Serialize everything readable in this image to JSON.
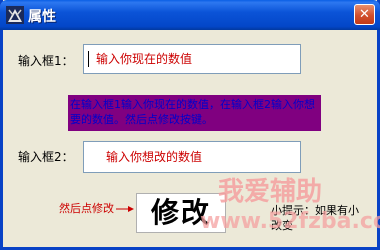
{
  "window": {
    "title": "属性",
    "close_glyph": "✕"
  },
  "field1": {
    "label": "输入框1：",
    "value": "输入你现在的数值"
  },
  "hint": {
    "text": "在输入框1输入你现在的数值，在输入框2输入你想要的数值。然后点修改按键。"
  },
  "field2": {
    "label": "输入框2：",
    "value": "输入你想改的数值"
  },
  "arrow_note": "然后点修改",
  "modify_button": {
    "label": "修改"
  },
  "side_note": "小提示：如果有小 改变",
  "watermark": {
    "brand": "我爱辅助",
    "url": "www.52fzba.com"
  },
  "colors": {
    "titlebar": "#0842c6",
    "hint_bg": "#800080",
    "hint_text": "#0000cc",
    "red_text": "#cc0000",
    "watermark": "#f4a0a0"
  }
}
